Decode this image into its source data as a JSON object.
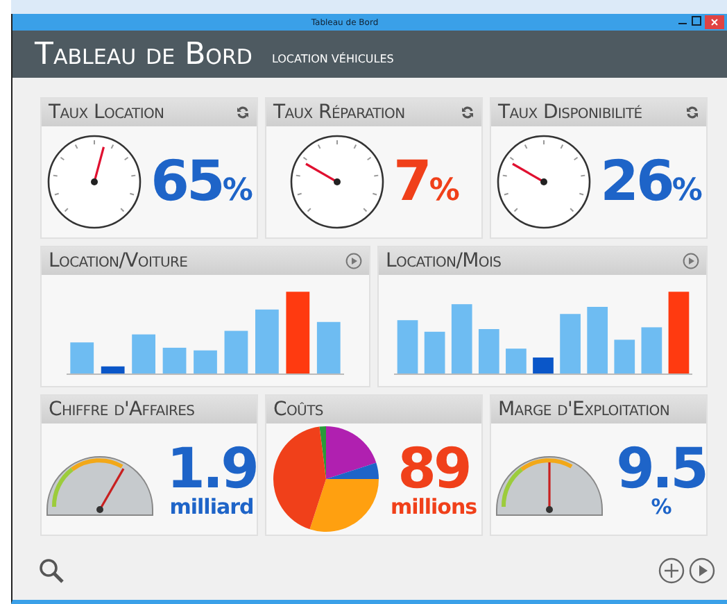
{
  "window": {
    "title": "Tableau de Bord"
  },
  "header": {
    "title": "Tableau de Bord",
    "subtitle": "LOCATION VÉHICULES"
  },
  "tiles": [
    {
      "kind": "dial",
      "title": "Taux Location",
      "value": "65",
      "unit": "%",
      "color": "#1e64c8"
    },
    {
      "kind": "dial",
      "title": "Taux Réparation",
      "value": "7",
      "unit": "%",
      "color": "#f0401a"
    },
    {
      "kind": "dial",
      "title": "Taux Disponibilité",
      "value": "26",
      "unit": "%",
      "color": "#1e64c8"
    },
    {
      "kind": "bars",
      "title": "Location/Voiture"
    },
    {
      "kind": "bars",
      "title": "Location/Mois"
    },
    {
      "kind": "semi",
      "title": "Chiffre d'Affaires",
      "value": "1.9",
      "unit": "milliard",
      "color": "#1e64c8"
    },
    {
      "kind": "pie",
      "title": "Coûts",
      "value": "89",
      "unit": "millions",
      "color": "#f0401a"
    },
    {
      "kind": "semi",
      "title": "Marge d'Exploitation",
      "value": "9.5",
      "unit": "%",
      "color": "#1e64c8"
    }
  ]
}
